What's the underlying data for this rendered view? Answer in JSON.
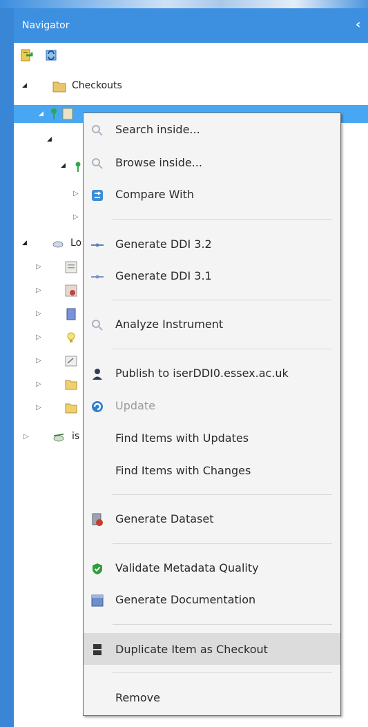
{
  "panel": {
    "title": "Navigator",
    "collapse_glyph": "‹"
  },
  "toolbar": {
    "icons": [
      "add-item-icon",
      "refresh-icon"
    ]
  },
  "tree": {
    "checkouts_label": "Checkouts",
    "partial_labels": {
      "lo": "Lo",
      "is": "is"
    }
  },
  "menu": {
    "search_inside": "Search inside...",
    "browse_inside": "Browse inside...",
    "compare_with": "Compare With",
    "generate_ddi_32": "Generate DDI 3.2",
    "generate_ddi_31": "Generate DDI 3.1",
    "analyze_instrument": "Analyze Instrument",
    "publish": "Publish to iserDDI0.essex.ac.uk",
    "update": "Update",
    "find_updates": "Find Items with Updates",
    "find_changes": "Find Items with Changes",
    "generate_dataset": "Generate Dataset",
    "validate_quality": "Validate Metadata Quality",
    "generate_docs": "Generate Documentation",
    "duplicate_checkout": "Duplicate Item as Checkout",
    "remove": "Remove"
  },
  "colors": {
    "header_bg": "#3d8fe0",
    "selected_row": "#48a7f2",
    "menu_bg": "#f4f4f4",
    "menu_highlight": "#dcdcdc"
  }
}
